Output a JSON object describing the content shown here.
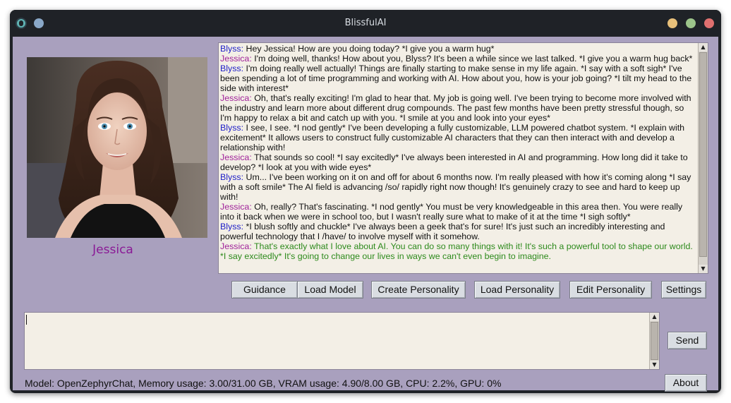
{
  "window": {
    "title": "BlissfulAI"
  },
  "character": {
    "name": "Jessica"
  },
  "chat": {
    "messages": [
      {
        "speaker": "Blyss:",
        "text": "Hey Jessica! How are you doing today? *I give you a warm hug*"
      },
      {
        "speaker": "Jessica:",
        "text": "I'm doing well, thanks! How about you, Blyss? It's been a while since we last talked. *I give you a warm hug back*"
      },
      {
        "speaker": "Blyss:",
        "text": "I'm doing really well actually! Things are finally starting to make sense in my life again. *I say with a soft sigh* I've been spending a lot of time programming and working with AI. How about you, how is your job going? *I tilt my head to the side with interest*"
      },
      {
        "speaker": "Jessica:",
        "text": "Oh, that's really exciting! I'm glad to hear that. My job is going well. I've been trying to become more involved with the industry and learn more about different drug compounds. The past few months have been pretty stressful though, so I'm happy to relax a bit and catch up with you. *I smile at you and look into your eyes*"
      },
      {
        "speaker": "Blyss:",
        "text": "I see, I see. *I nod gently* I've been developing a fully customizable, LLM powered chatbot system. *I explain with excitement* It allows users to construct fully customizable AI characters that they can then interact with and develop a relationship with!"
      },
      {
        "speaker": "Jessica:",
        "text": "That sounds so cool! *I say excitedly* I've always been interested in AI and programming. How long did it take to develop? *I look at you with wide eyes*"
      },
      {
        "speaker": "Blyss:",
        "text": "Um... I've been working on it on and off for about 6 months now. I'm really pleased with how it's coming along *I say with a soft smile* The AI field is advancing /so/ rapidly right now though! It's genuinely crazy to see and hard to keep up with!"
      },
      {
        "speaker": "Jessica:",
        "text": "Oh, really? That's fascinating. *I nod gently* You must be very knowledgeable in this area then. You were really into it back when we were in school too, but I wasn't really sure what to make of it at the time *I sigh softly*"
      },
      {
        "speaker": "Blyss:",
        "text": "*I blush softly and chuckle* I've always been a geek that's for sure! It's just such an incredibly interesting and powerful technology that I /have/ to involve myself with it somehow."
      },
      {
        "speaker": "Jessica:",
        "text": "That's exactly what I love about AI. You can do so many things with it! It's such a powerful tool to shape our world. *I say excitedly* It's going to change our lives in ways we can't even begin to imagine."
      }
    ]
  },
  "toolbar": {
    "guidance": "Guidance",
    "load_model": "Load Model",
    "create_personality": "Create Personality",
    "load_personality": "Load Personality",
    "edit_personality": "Edit Personality",
    "settings": "Settings"
  },
  "input": {
    "value": "",
    "send": "Send"
  },
  "status": {
    "text": "Model: OpenZephyrChat, Memory usage: 3.00/31.00 GB, VRAM usage: 4.90/8.00 GB, CPU: 2.2%, GPU: 0%",
    "about": "About"
  },
  "colors": {
    "background": "#a9a0be",
    "blyss_speaker": "#2020c8",
    "jessica_speaker": "#a0229a",
    "latest_message": "#2d8a1c",
    "character_name": "#8a1a96"
  }
}
